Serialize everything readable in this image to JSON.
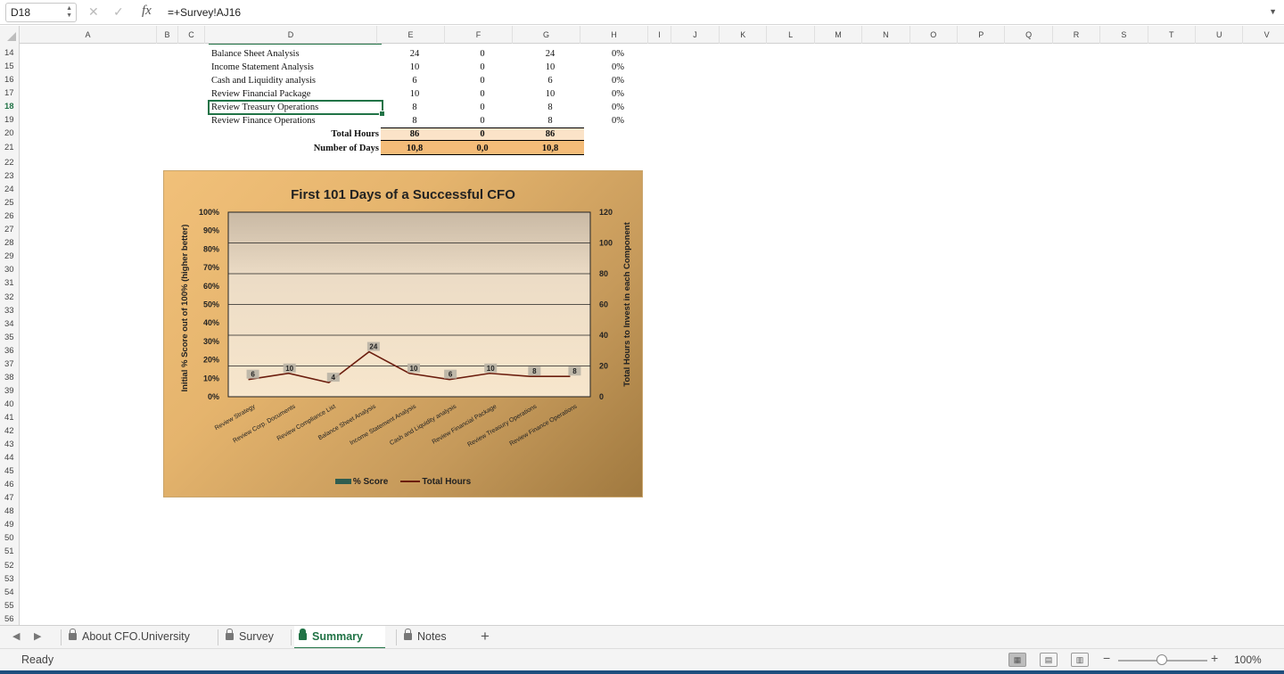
{
  "formula_bar": {
    "name_box": "D18",
    "cancel_glyph": "✕",
    "enter_glyph": "✓",
    "fx_label": "fx",
    "formula": "=+Survey!AJ16"
  },
  "columns": [
    "A",
    "B",
    "C",
    "D",
    "E",
    "F",
    "G",
    "H",
    "I",
    "J",
    "K",
    "L",
    "M",
    "N",
    "O",
    "P",
    "Q",
    "R",
    "S",
    "T",
    "U",
    "V"
  ],
  "rows": [
    14,
    15,
    16,
    17,
    18,
    19,
    20,
    21,
    22,
    23,
    24,
    25,
    26,
    27,
    28,
    29,
    30,
    31,
    32,
    33,
    34,
    35,
    36,
    37,
    38,
    39,
    40,
    41,
    42,
    43,
    44,
    45,
    46,
    47,
    48,
    49,
    50,
    51,
    52,
    53,
    54,
    55,
    56
  ],
  "selected_row": 18,
  "table": {
    "items": [
      {
        "name": "Balance Sheet Analysis",
        "e": "24",
        "f": "0",
        "g": "24",
        "h": "0%"
      },
      {
        "name": "Income Statement Analysis",
        "e": "10",
        "f": "0",
        "g": "10",
        "h": "0%"
      },
      {
        "name": "Cash and Liquidity analysis",
        "e": "6",
        "f": "0",
        "g": "6",
        "h": "0%"
      },
      {
        "name": "Review Financial Package",
        "e": "10",
        "f": "0",
        "g": "10",
        "h": "0%"
      },
      {
        "name": "Review Treasury Operations",
        "e": "8",
        "f": "0",
        "g": "8",
        "h": "0%"
      },
      {
        "name": "Review Finance Operations",
        "e": "8",
        "f": "0",
        "g": "8",
        "h": "0%"
      }
    ],
    "total_label": "Total Hours",
    "total": {
      "e": "86",
      "f": "0",
      "g": "86"
    },
    "days_label": "Number of Days",
    "days": {
      "e": "10,8",
      "f": "0,0",
      "g": "10,8"
    }
  },
  "chart_data": {
    "type": "bar",
    "title": "First 101 Days of a Successful CFO",
    "categories": [
      "Review Strategy",
      "Review Corp. Documents",
      "Review Compliance List",
      "Balance Sheet Analysis",
      "Income Statement Analysis",
      "Cash and Liquidity analysis",
      "Review Financial Package",
      "Review Treasury Operations",
      "Review Finance Operations"
    ],
    "series": [
      {
        "name": "% Score",
        "type": "bar",
        "axis": "left",
        "values": [
          0,
          0,
          0,
          0,
          0,
          0,
          0,
          0,
          0
        ],
        "color": "#2f5d50"
      },
      {
        "name": "Total Hours",
        "type": "line",
        "axis": "right",
        "values": [
          6,
          10,
          4,
          24,
          10,
          6,
          10,
          8,
          8
        ],
        "color": "#6b1d0e"
      }
    ],
    "ylabel": "Initial % Score out of 100% (higher better)",
    "y2label": "Total Hours to Invest in each Component",
    "ylim": [
      0,
      100
    ],
    "y_ticks": [
      "0%",
      "10%",
      "20%",
      "30%",
      "40%",
      "50%",
      "60%",
      "70%",
      "80%",
      "90%",
      "100%"
    ],
    "y2lim": [
      0,
      120
    ],
    "y2_ticks": [
      "0",
      "20",
      "40",
      "60",
      "80",
      "100",
      "120"
    ],
    "legend": "bottom",
    "grid": true
  },
  "sheet_tabs": [
    {
      "label": "About CFO.University",
      "active": false
    },
    {
      "label": "Survey",
      "active": false
    },
    {
      "label": "Summary",
      "active": true
    },
    {
      "label": "Notes",
      "active": false
    }
  ],
  "add_sheet_glyph": "+",
  "status": {
    "text": "Ready",
    "zoom": "100%"
  }
}
